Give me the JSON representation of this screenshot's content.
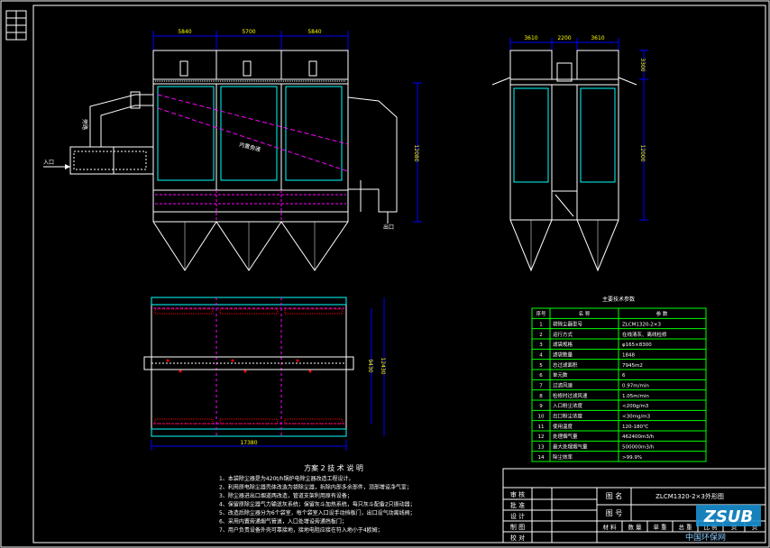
{
  "dims": {
    "front_top": [
      "5840",
      "5700",
      "5840"
    ],
    "front_height": "12080",
    "side_top": [
      "3610",
      "2200",
      "3610"
    ],
    "side_upper": "3300",
    "side_height": "12000",
    "plan_inner": "9430",
    "plan_outer": "12430",
    "plan_width": "17380"
  },
  "labels": {
    "bypass": "旁路",
    "inlet": "入口",
    "inner_bypass": "内置旁通",
    "outlet": "出口"
  },
  "params": {
    "title": "主要技术参数",
    "headers": [
      "序号",
      "名    称",
      "参    数"
    ],
    "rows": [
      [
        "1",
        "袋除尘器型号",
        "ZLCM1320-2×3"
      ],
      [
        "2",
        "运行方式",
        "在线清灰、离线检修"
      ],
      [
        "3",
        "滤袋规格",
        "φ165×8300"
      ],
      [
        "4",
        "滤袋数量",
        "1848"
      ],
      [
        "5",
        "总过滤面积",
        "7945m2"
      ],
      [
        "6",
        "单元数",
        "6"
      ],
      [
        "7",
        "过滤风速",
        "0.97m/min"
      ],
      [
        "8",
        "检修时过滤风速",
        "1.05m/min"
      ],
      [
        "9",
        "入口粉尘浓度",
        "<200g/m3"
      ],
      [
        "10",
        "出口粉尘浓度",
        "<30mg/m3"
      ],
      [
        "11",
        "使用温度",
        "120-180℃"
      ],
      [
        "12",
        "处理烟气量",
        "462400m3/h"
      ],
      [
        "13",
        "最大处理烟气量",
        "500000m3/h"
      ],
      [
        "14",
        "除尘效率",
        ">99.9%"
      ]
    ]
  },
  "notes": {
    "title": "方案 2 技 术 说 明",
    "lines": [
      "1、本袋除尘器是为420t/h锅炉电除尘器改造工程设计。",
      "2、利用原电除尘器壳体改造为袋除尘器，拆除内部多余部件，顶部增设净气室；",
      "3、除尘器进出口烟道两改造，管道支架利用原有设备；",
      "4、保留原除尘器气力输送灰系统；保留灰斗加热系统，每只灰斗配备2只振动器；",
      "5、改造后除尘器分为6个袋室，每个袋室入口设手动挡板门，出口设气动离线阀；",
      "6、采用内置旁通烟气管道，入口处增设旁通挡板门；",
      "7、用户负责设备外壳可靠接地，接地电阻应接在符入地小于4欧姆；"
    ]
  },
  "title_block": {
    "review": "审 核",
    "approve": "批 准",
    "design": "设 计",
    "draw": "制 图",
    "check": "校 对",
    "drawing_name_label": "图 名",
    "drawing_name": "ZLCM1320-2×3外形图",
    "drawing_no_label": "图 号",
    "bottom": [
      "材 料",
      "数 量",
      "单 重",
      "总 重",
      "比 例",
      "页",
      "页"
    ]
  },
  "watermark": {
    "logo": "ZSUB",
    "site": "中国环保网"
  }
}
